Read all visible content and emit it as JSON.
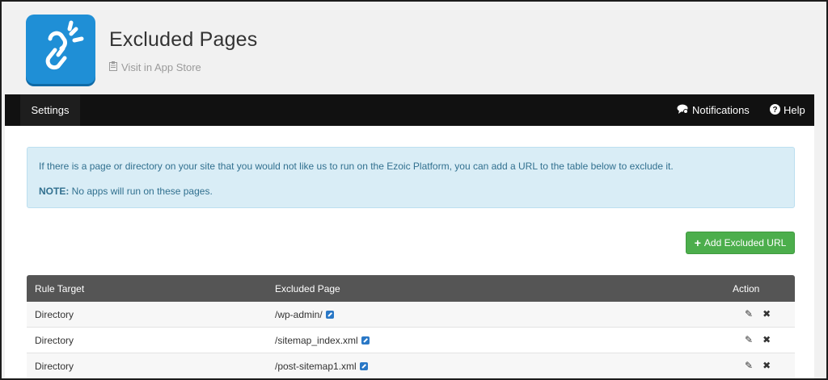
{
  "app": {
    "title": "Excluded Pages",
    "store_link": "Visit in App Store",
    "icon_name": "broken-link-icon",
    "icon_color": "#1f8fd6"
  },
  "nav": {
    "settings": "Settings",
    "notifications": "Notifications",
    "help": "Help"
  },
  "alert": {
    "text": "If there is a page or directory on your site that you would not like us to run on the Ezoic Platform, you can add a URL to the table below to exclude it.",
    "note_label": "NOTE:",
    "note_text": " No apps will run on these pages."
  },
  "add_button": {
    "label": "Add Excluded URL",
    "color": "#4cae4c"
  },
  "table": {
    "headers": [
      "Rule Target",
      "Excluded Page",
      "Action"
    ],
    "rows": [
      {
        "target": "Directory",
        "page": "/wp-admin/"
      },
      {
        "target": "Directory",
        "page": "/sitemap_index.xml"
      },
      {
        "target": "Directory",
        "page": "/post-sitemap1.xml"
      }
    ]
  }
}
